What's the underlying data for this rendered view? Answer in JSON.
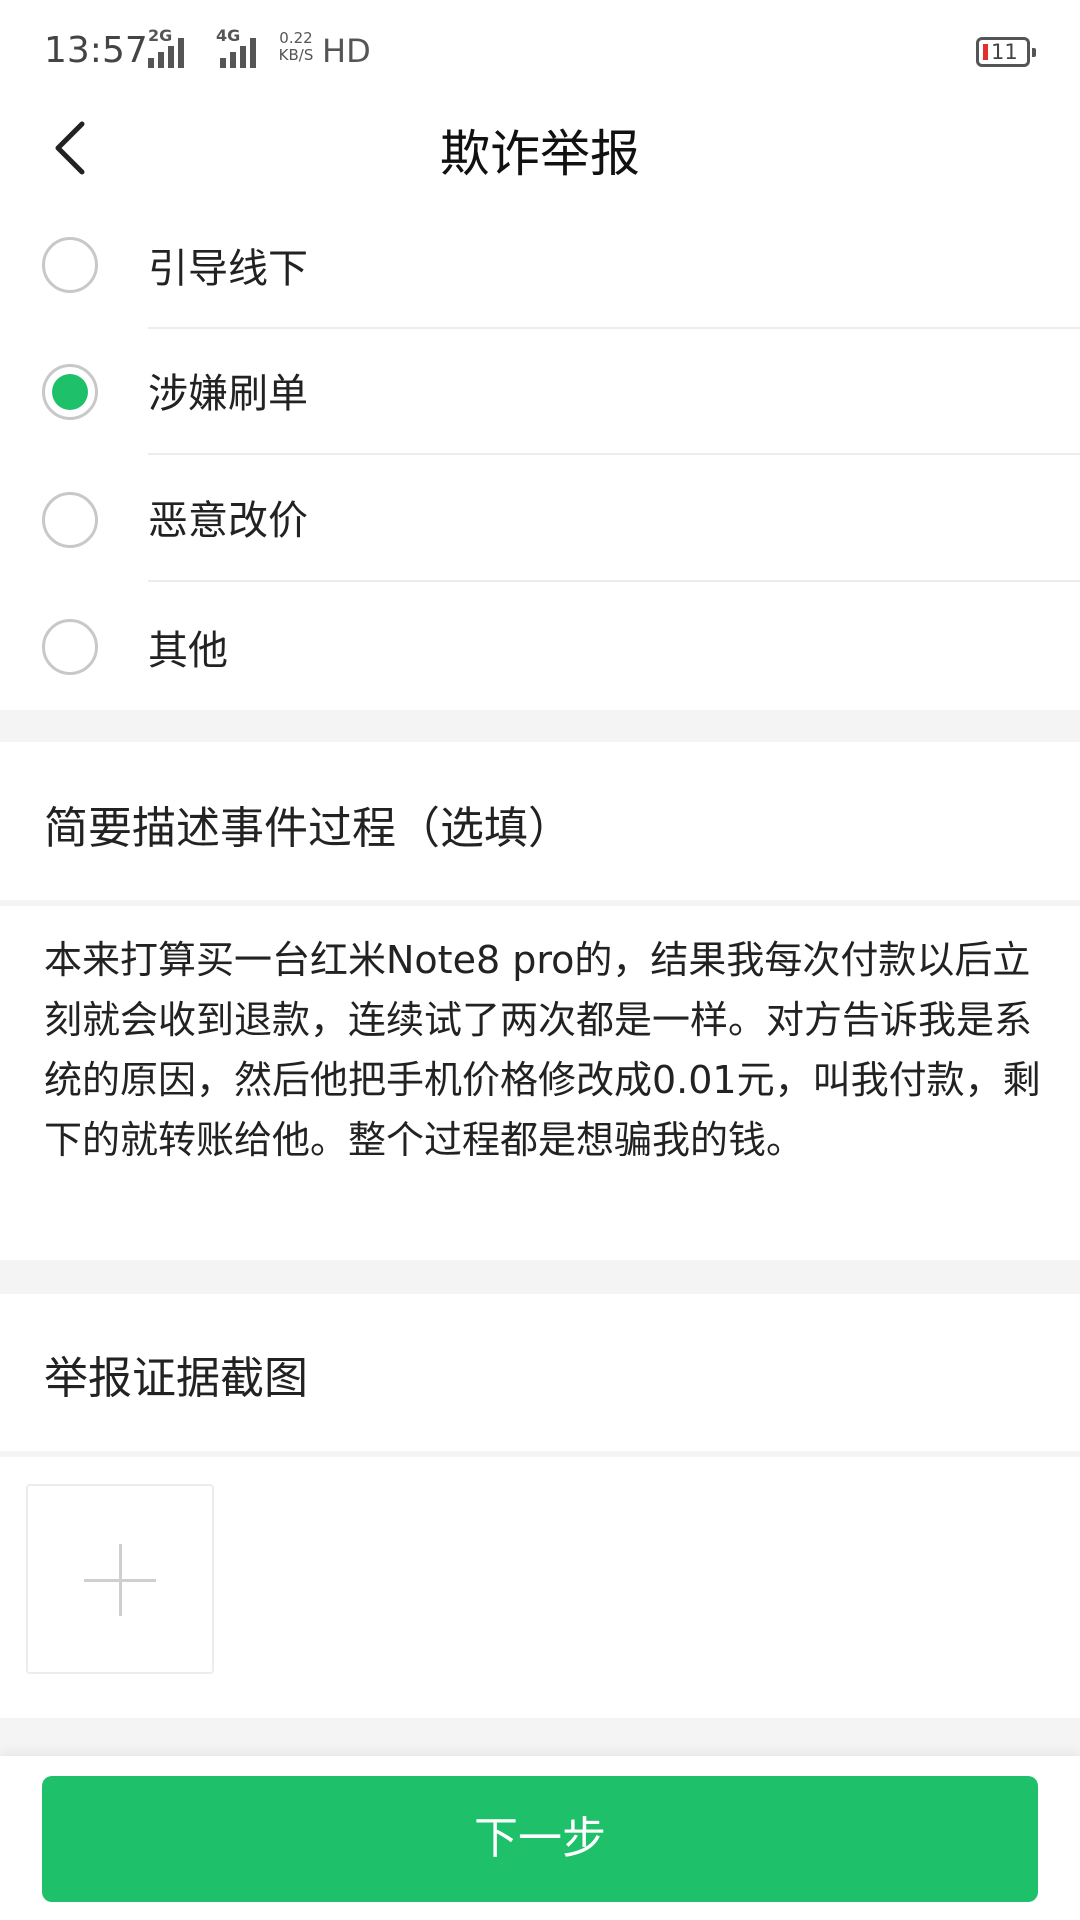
{
  "status_bar": {
    "time": "13:57",
    "signal1_tag": "2G",
    "signal2_tag": "4G",
    "net_speed_value": "0.22",
    "net_speed_unit": "KB/S",
    "hd_label": "HD",
    "battery_level": "11",
    "icons": [
      "signal-icon",
      "signal-icon",
      "battery-icon"
    ]
  },
  "header": {
    "title": "欺诈举报",
    "back_icon": "chevron-left-icon"
  },
  "report_options": {
    "items": [
      {
        "label": "引导线下",
        "selected": false
      },
      {
        "label": "涉嫌刷单",
        "selected": true
      },
      {
        "label": "恶意改价",
        "selected": false
      },
      {
        "label": "其他",
        "selected": false
      }
    ]
  },
  "description": {
    "title": "简要描述事件过程（选填）",
    "text": "本来打算买一台红米Note8 pro的，结果我每次付款以后立刻就会收到退款，连续试了两次都是一样。对方告诉我是系统的原因，然后他把手机价格修改成0.01元，叫我付款，剩下的就转账给他。整个过程都是想骗我的钱。"
  },
  "evidence": {
    "title": "举报证据截图",
    "add_icon": "plus-icon"
  },
  "footer": {
    "next_label": "下一步"
  },
  "colors": {
    "accent": "#1ec06a",
    "section_bg": "#f4f4f4"
  }
}
